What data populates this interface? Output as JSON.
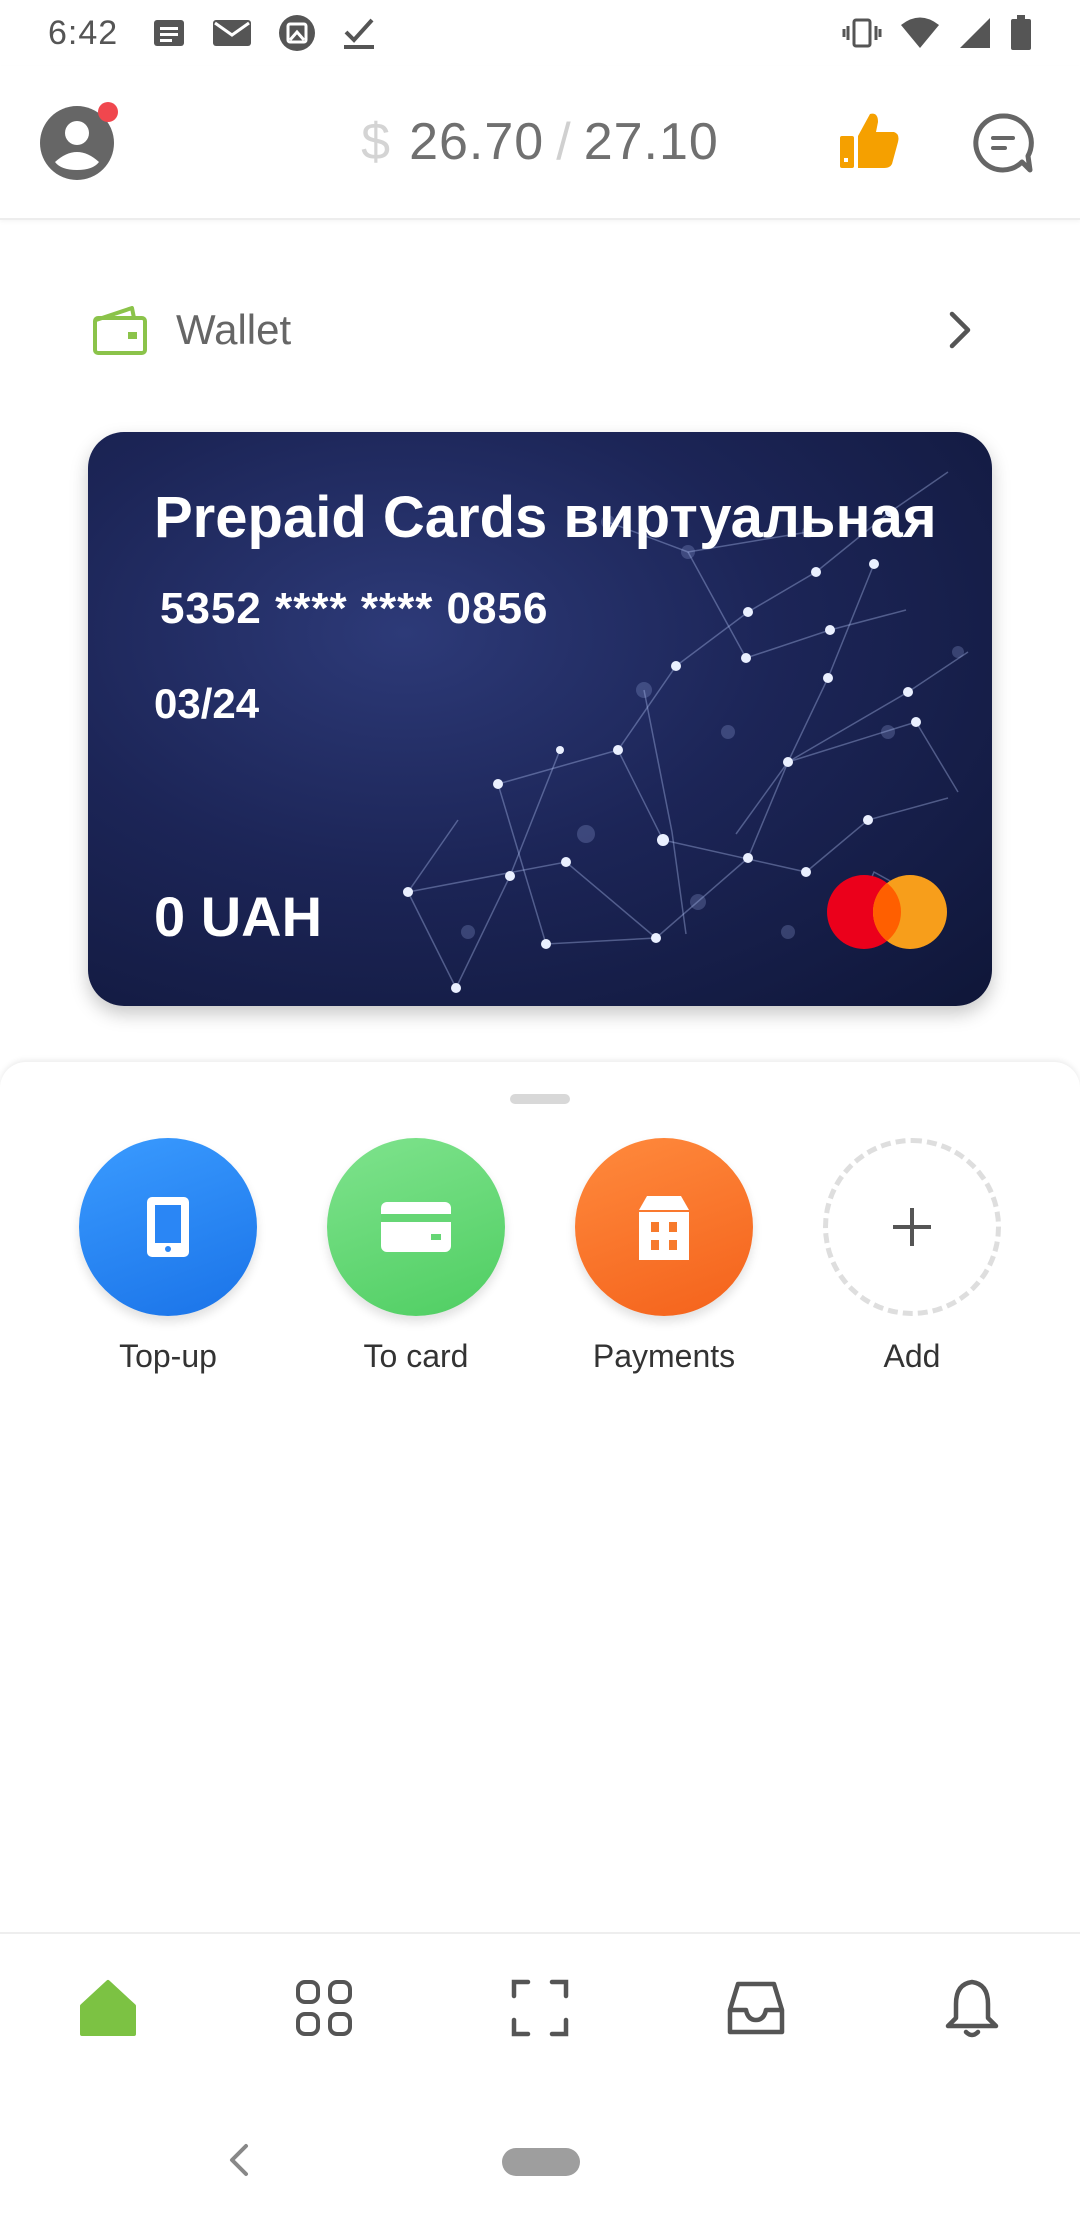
{
  "status_bar": {
    "time": "6:42",
    "left_icons": [
      "notes-icon",
      "mail-icon",
      "photo-icon",
      "check-icon"
    ],
    "right_icons": [
      "vibrate-icon",
      "wifi-icon",
      "signal-icon",
      "battery-icon"
    ]
  },
  "header": {
    "currency_symbol": "$",
    "balance_primary": "26.70",
    "balance_separator": "/",
    "balance_secondary": "27.10",
    "thumb_color": "#f5a000"
  },
  "wallet": {
    "label": "Wallet",
    "accent": "#8bc34a"
  },
  "card": {
    "title": "Prepaid Cards виртуальная",
    "number": "5352 **** **** 0856",
    "expiry": "03/24",
    "balance": "0 UAH",
    "brand_icon": "mastercard-logo"
  },
  "actions": [
    {
      "label": "Top-up",
      "icon": "phone-icon",
      "color": "#1a73e8"
    },
    {
      "label": "To card",
      "icon": "card-icon",
      "color": "#4fce62"
    },
    {
      "label": "Payments",
      "icon": "building-icon",
      "color": "#f4621b"
    },
    {
      "label": "Add",
      "icon": "plus-icon",
      "color": "#dedede"
    }
  ],
  "bottom_nav": {
    "items": [
      "home-icon",
      "apps-icon",
      "scan-icon",
      "inbox-icon",
      "bell-icon"
    ],
    "active": "home-icon",
    "active_color": "#7cc243"
  }
}
